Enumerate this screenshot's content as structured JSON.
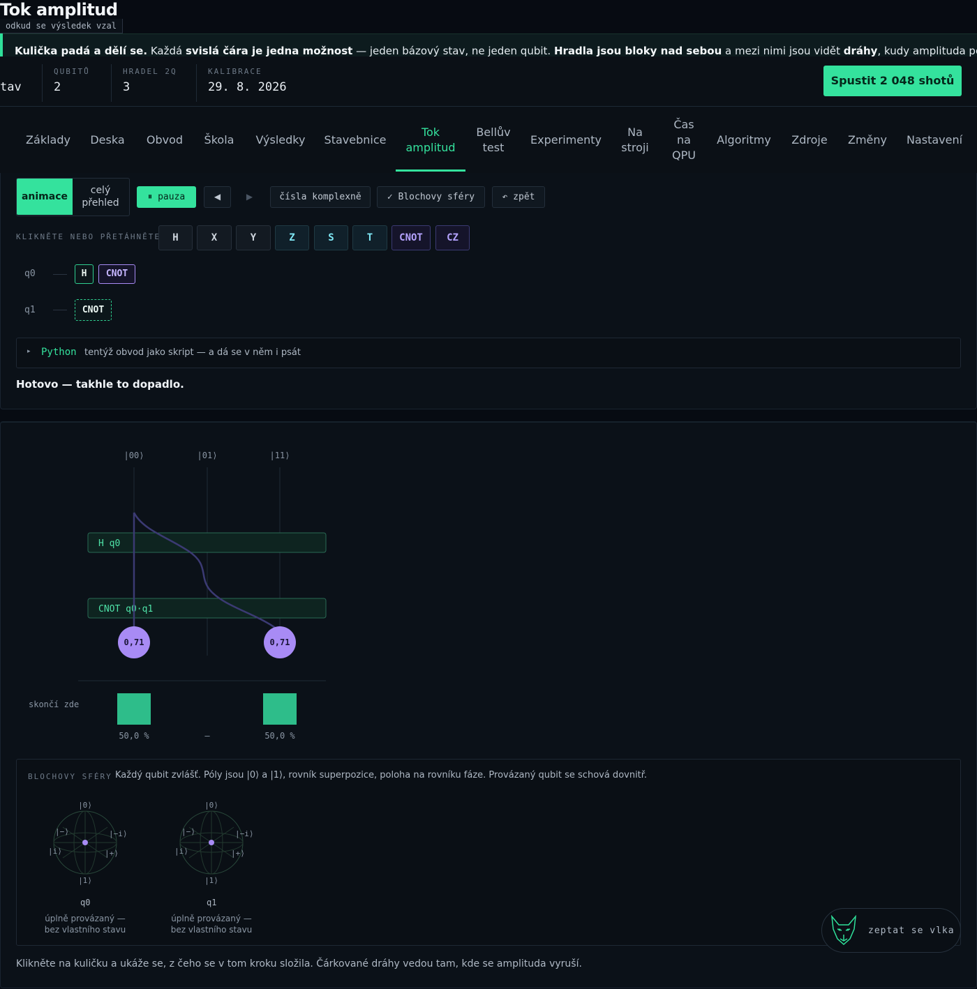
{
  "header": {
    "title": "Tok amplitud",
    "subtitle": "odkud se výsledek vzal"
  },
  "banner": {
    "p1": "Kulička padá a dělí se.",
    "p2": " Každá ",
    "p3": "svislá čára je jedna možnost",
    "p4": " — jeden bázový stav, ne jeden qubit. ",
    "p5": "Hradla jsou bloky nad sebou",
    "p6": " a mezi nimi jsou vidět ",
    "p7": "dráhy",
    "p8": ", kudy amplituda poteče. Kulička po"
  },
  "stats": {
    "cut_value": "tav",
    "qubits_label": "QUBITŮ",
    "qubits_value": "2",
    "gates_label": "HRADEL 2Q",
    "gates_value": "3",
    "calib_label": "KALIBRACE",
    "calib_value": "29. 8. 2026",
    "run_button": "Spustit 2 048 shotů"
  },
  "nav": {
    "tabs": [
      "Základy",
      "Deska",
      "Obvod",
      "Škola",
      "Výsledky",
      "Stavebnice",
      "Tok amplitud",
      "Bellův test",
      "Experimenty",
      "Na stroji",
      "Čas na QPU",
      "Algoritmy",
      "Zdroje",
      "Změny",
      "Nastavení"
    ],
    "active": "Tok amplitud"
  },
  "toolbar": {
    "mode_animation": "animace",
    "mode_overview": "celý přehled",
    "pause": "⏸ pauza",
    "prev": "◀",
    "next": "▶",
    "complex": "čísla komplexně",
    "bloch": "✓ Blochovy sféry",
    "undo": "↶ zpět"
  },
  "palette": {
    "hint": "KLIKNĚTE NEBO PŘETÁHNĚTE",
    "gates": [
      "H",
      "X",
      "Y",
      "Z",
      "S",
      "T",
      "CNOT",
      "CZ"
    ]
  },
  "circuit": {
    "q0_label": "q0",
    "q1_label": "q1",
    "q0_gates": [
      "H",
      "CNOT"
    ],
    "q1_gates": [
      "CNOT"
    ]
  },
  "python": {
    "arrow": "▸",
    "label": "Python",
    "desc": "tentýž obvod jako skript — a dá se v něm i psát"
  },
  "done_text": "Hotovo — takhle to dopadlo.",
  "flow": {
    "states": [
      "|00⟩",
      "|01⟩",
      "|11⟩"
    ],
    "gate1": "H q0",
    "gate2": "CNOT q0·q1",
    "balls": [
      "0,71",
      "0,71"
    ],
    "ends_label": "skončí zde",
    "results": [
      "50,0 %",
      "–",
      "50,0 %"
    ],
    "result_probabilities": [
      0.5,
      0,
      0.5
    ]
  },
  "bloch": {
    "label": "BLOCHOVY SFÉRY",
    "desc": "Každý qubit zvlášť. Póly jsou |0⟩ a |1⟩, rovník superpozice, poloha na rovníku fáze. Provázaný qubit se schová dovnitř.",
    "spheres": [
      {
        "name": "q0",
        "note": "úplně provázaný — bez vlastního stavu"
      },
      {
        "name": "q1",
        "note": "úplně provázaný — bez vlastního stavu"
      }
    ],
    "axes": {
      "top": "|0⟩",
      "bottom": "|1⟩",
      "left": "|i⟩",
      "right": "|+⟩",
      "back_left": "|−⟩",
      "back_right": "|−i⟩"
    }
  },
  "footer_text": "Klikněte na kuličku a ukáže se, z čeho se v tom kroku složila. Čárkované dráhy vedou tam, kde se amplituda vyruší.",
  "wolf": {
    "label": "zeptat se vlka",
    "icon": "wolf-icon"
  },
  "colors": {
    "accent": "#34e29d",
    "purple": "#a88bf5",
    "teal": "#7fe8f5"
  }
}
